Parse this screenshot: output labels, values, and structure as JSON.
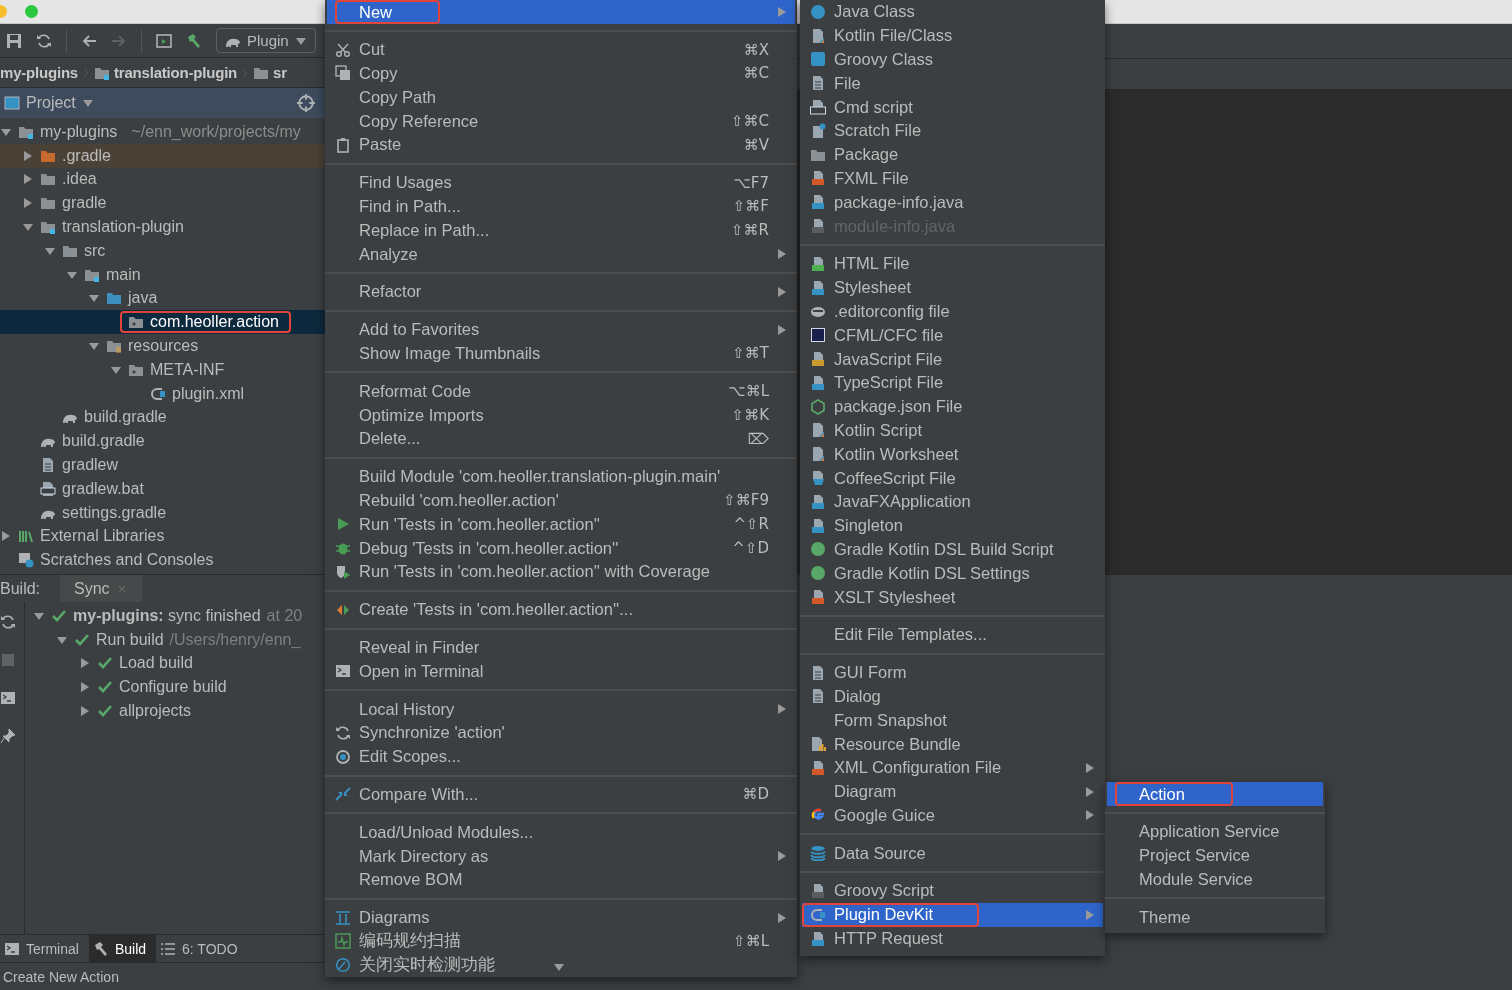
{
  "toolbar": {
    "run_config": "Plugin"
  },
  "breadcrumbs": [
    {
      "label": "my-plugins",
      "kind": "none"
    },
    {
      "label": "translation-plugin",
      "kind": "module"
    },
    {
      "label": "sr",
      "kind": "folder"
    }
  ],
  "project_panel": {
    "title": "Project",
    "tree": [
      {
        "label": "my-plugins",
        "path": "~/enn_work/projects/my",
        "kind": "module",
        "expanded": true,
        "selected": false,
        "children": [
          {
            "label": ".gradle",
            "kind": "folder-orange",
            "expanded": false,
            "excluded": true,
            "selected": false
          },
          {
            "label": ".idea",
            "kind": "folder",
            "expanded": false,
            "selected": false
          },
          {
            "label": "gradle",
            "kind": "folder",
            "expanded": false,
            "selected": false
          },
          {
            "label": "translation-plugin",
            "kind": "module",
            "expanded": true,
            "selected": false,
            "children": [
              {
                "label": "src",
                "kind": "folder",
                "expanded": true,
                "selected": false,
                "children": [
                  {
                    "label": "main",
                    "kind": "module",
                    "expanded": true,
                    "selected": false,
                    "children": [
                      {
                        "label": "java",
                        "kind": "source",
                        "expanded": true,
                        "selected": false,
                        "children": [
                          {
                            "label": "com.heoller.action",
                            "kind": "package",
                            "selected": true,
                            "boxed": true
                          }
                        ]
                      },
                      {
                        "label": "resources",
                        "kind": "resources",
                        "expanded": true,
                        "selected": false,
                        "children": [
                          {
                            "label": "META-INF",
                            "kind": "package",
                            "expanded": true,
                            "selected": false,
                            "children": [
                              {
                                "label": "plugin.xml",
                                "kind": "plugin",
                                "selected": false
                              }
                            ]
                          }
                        ]
                      }
                    ]
                  }
                ]
              },
              {
                "label": "build.gradle",
                "kind": "gradle",
                "selected": false
              }
            ]
          },
          {
            "label": "build.gradle",
            "kind": "gradle",
            "selected": false
          },
          {
            "label": "gradlew",
            "kind": "file",
            "selected": false
          },
          {
            "label": "gradlew.bat",
            "kind": "bat",
            "selected": false
          },
          {
            "label": "settings.gradle",
            "kind": "gradle",
            "selected": false
          }
        ]
      },
      {
        "label": "External Libraries",
        "kind": "libraries",
        "expanded": false,
        "selected": false
      },
      {
        "label": "Scratches and Consoles",
        "kind": "scratches",
        "selected": false
      }
    ]
  },
  "build_panel": {
    "label": "Build:",
    "tab": "Sync",
    "tree": [
      {
        "label": "**my-plugins:** sync finished",
        "detail": "at 20",
        "expanded": true,
        "children": [
          {
            "label": "Run build",
            "detail": "/Users/henry/enn_",
            "expanded": true,
            "children": [
              {
                "label": "Load build",
                "expanded": false
              },
              {
                "label": "Configure build",
                "expanded": false
              },
              {
                "label": "allprojects",
                "expanded": false
              }
            ]
          }
        ]
      }
    ]
  },
  "bottom_tabs": [
    {
      "label": "Terminal",
      "kind": "terminal",
      "selected": false
    },
    {
      "label": "Build",
      "kind": "hammer",
      "selected": true
    },
    {
      "label": "6: TODO",
      "kind": "list",
      "selected": false
    }
  ],
  "status_bar": "Create New Action",
  "context_menu": [
    [
      {
        "label": "New",
        "submenu": true,
        "selected": true,
        "boxed": true
      }
    ],
    [
      {
        "label": "Cut",
        "shortcut": "⌘X",
        "kind": "scissors",
        "selected": false
      },
      {
        "label": "Copy",
        "shortcut": "⌘C",
        "kind": "copy",
        "selected": false
      },
      {
        "label": "Copy Path",
        "selected": false
      },
      {
        "label": "Copy Reference",
        "shortcut": "⇧⌘C",
        "selected": false
      },
      {
        "label": "Paste",
        "shortcut": "⌘V",
        "kind": "paste",
        "selected": false
      }
    ],
    [
      {
        "label": "Find Usages",
        "shortcut": "⌥F7",
        "selected": false
      },
      {
        "label": "Find in Path...",
        "shortcut": "⇧⌘F",
        "selected": false
      },
      {
        "label": "Replace in Path...",
        "shortcut": "⇧⌘R",
        "selected": false
      },
      {
        "label": "Analyze",
        "submenu": true,
        "selected": false
      }
    ],
    [
      {
        "label": "Refactor",
        "submenu": true,
        "selected": false
      }
    ],
    [
      {
        "label": "Add to Favorites",
        "submenu": true,
        "selected": false
      },
      {
        "label": "Show Image Thumbnails",
        "shortcut": "⇧⌘T",
        "selected": false
      }
    ],
    [
      {
        "label": "Reformat Code",
        "shortcut": "⌥⌘L",
        "selected": false
      },
      {
        "label": "Optimize Imports",
        "shortcut": "⇧⌘K",
        "selected": false
      },
      {
        "label": "Delete...",
        "shortcut": "⌦",
        "selected": false
      }
    ],
    [
      {
        "label": "Build Module 'com.heoller.translation-plugin.main'",
        "selected": false
      },
      {
        "label": "Rebuild 'com.heoller.action'",
        "shortcut": "⇧⌘F9",
        "selected": false
      },
      {
        "label": "Run 'Tests in 'com.heoller.action''",
        "shortcut": "^⇧R",
        "kind": "run",
        "selected": false
      },
      {
        "label": "Debug 'Tests in 'com.heoller.action''",
        "shortcut": "^⇧D",
        "kind": "bug",
        "selected": false
      },
      {
        "label": "Run 'Tests in 'com.heoller.action'' with Coverage",
        "kind": "coverage",
        "selected": false
      }
    ],
    [
      {
        "label": "Create 'Tests in 'com.heoller.action''...",
        "kind": "create-test",
        "selected": false
      }
    ],
    [
      {
        "label": "Reveal in Finder",
        "selected": false
      },
      {
        "label": "Open in Terminal",
        "kind": "terminal",
        "selected": false
      }
    ],
    [
      {
        "label": "Local History",
        "submenu": true,
        "selected": false
      },
      {
        "label": "Synchronize 'action'",
        "kind": "sync",
        "selected": false
      },
      {
        "label": "Edit Scopes...",
        "kind": "scope",
        "selected": false
      }
    ],
    [
      {
        "label": "Compare With...",
        "shortcut": "⌘D",
        "kind": "compare",
        "selected": false
      }
    ],
    [
      {
        "label": "Load/Unload Modules...",
        "selected": false
      },
      {
        "label": "Mark Directory as",
        "submenu": true,
        "selected": false
      },
      {
        "label": "Remove BOM",
        "selected": false
      }
    ],
    [
      {
        "label": "Diagrams",
        "submenu": true,
        "kind": "diagram",
        "selected": false
      },
      {
        "label": "编码规约扫描",
        "shortcut": "⇧⌘L",
        "kind": "scan",
        "selected": false
      },
      {
        "label": "关闭实时检测功能",
        "kind": "gauge",
        "selected": false
      }
    ]
  ],
  "new_menu": [
    [
      {
        "label": "Java Class",
        "kind": "circle-blue",
        "selected": false
      },
      {
        "label": "Kotlin File/Class",
        "kind": "kotlin",
        "selected": false
      },
      {
        "label": "Groovy Class",
        "kind": "square-teal",
        "selected": false
      },
      {
        "label": "File",
        "kind": "file",
        "selected": false
      },
      {
        "label": "Cmd script",
        "kind": "cmd",
        "selected": false
      },
      {
        "label": "Scratch File",
        "kind": "scratch",
        "selected": false
      },
      {
        "label": "Package",
        "kind": "folder",
        "selected": false
      },
      {
        "label": "FXML File",
        "kind": "doc-orange",
        "selected": false
      },
      {
        "label": "package-info.java",
        "kind": "doc-blue",
        "selected": false
      },
      {
        "label": "module-info.java",
        "kind": "doc-gray",
        "disabled": true,
        "selected": false
      }
    ],
    [
      {
        "label": "HTML File",
        "kind": "doc-green",
        "selected": false
      },
      {
        "label": "Stylesheet",
        "kind": "doc-blue",
        "selected": false
      },
      {
        "label": ".editorconfig file",
        "kind": "blob",
        "selected": false
      },
      {
        "label": "CFML/CFC file",
        "kind": "square-navy",
        "selected": false
      },
      {
        "label": "JavaScript File",
        "kind": "doc-yellow",
        "selected": false
      },
      {
        "label": "TypeScript File",
        "kind": "doc-blue",
        "selected": false
      },
      {
        "label": "package.json File",
        "kind": "hexagon",
        "selected": false
      },
      {
        "label": "Kotlin Script",
        "kind": "kotlin",
        "selected": false
      },
      {
        "label": "Kotlin Worksheet",
        "kind": "kotlin",
        "selected": false
      },
      {
        "label": "CoffeeScript File",
        "kind": "cup",
        "selected": false
      },
      {
        "label": "JavaFXApplication",
        "kind": "doc-blue",
        "selected": false
      },
      {
        "label": "Singleton",
        "kind": "doc-blue",
        "selected": false
      },
      {
        "label": "Gradle Kotlin DSL Build Script",
        "kind": "circle-green",
        "selected": false
      },
      {
        "label": "Gradle Kotlin DSL Settings",
        "kind": "circle-green",
        "selected": false
      },
      {
        "label": "XSLT Stylesheet",
        "kind": "doc-orange",
        "selected": false
      }
    ],
    [
      {
        "label": "Edit File Templates...",
        "selected": false
      }
    ],
    [
      {
        "label": "GUI Form",
        "kind": "file",
        "selected": false
      },
      {
        "label": "Dialog",
        "kind": "file",
        "selected": false
      },
      {
        "label": "Form Snapshot",
        "selected": false
      },
      {
        "label": "Resource Bundle",
        "kind": "bundle",
        "selected": false
      },
      {
        "label": "XML Configuration File",
        "kind": "doc-orange",
        "submenu": true,
        "selected": false
      },
      {
        "label": "Diagram",
        "submenu": true,
        "selected": false
      },
      {
        "label": "Google Guice",
        "kind": "google",
        "submenu": true,
        "selected": false
      }
    ],
    [
      {
        "label": "Data Source",
        "kind": "database",
        "selected": false
      }
    ],
    [
      {
        "label": "Groovy Script",
        "kind": "doc-gray",
        "selected": false
      },
      {
        "label": "Plugin DevKit",
        "kind": "plugin",
        "submenu": true,
        "selected": true,
        "boxed": true
      },
      {
        "label": "HTTP Request",
        "kind": "doc-blue",
        "selected": false
      }
    ]
  ],
  "devkit_menu": [
    [
      {
        "label": "Action",
        "selected": true,
        "boxed": true
      }
    ],
    [
      {
        "label": "Application Service",
        "selected": false
      },
      {
        "label": "Project Service",
        "selected": false
      },
      {
        "label": "Module Service",
        "selected": false
      }
    ],
    [
      {
        "label": "Theme",
        "selected": false
      }
    ]
  ]
}
